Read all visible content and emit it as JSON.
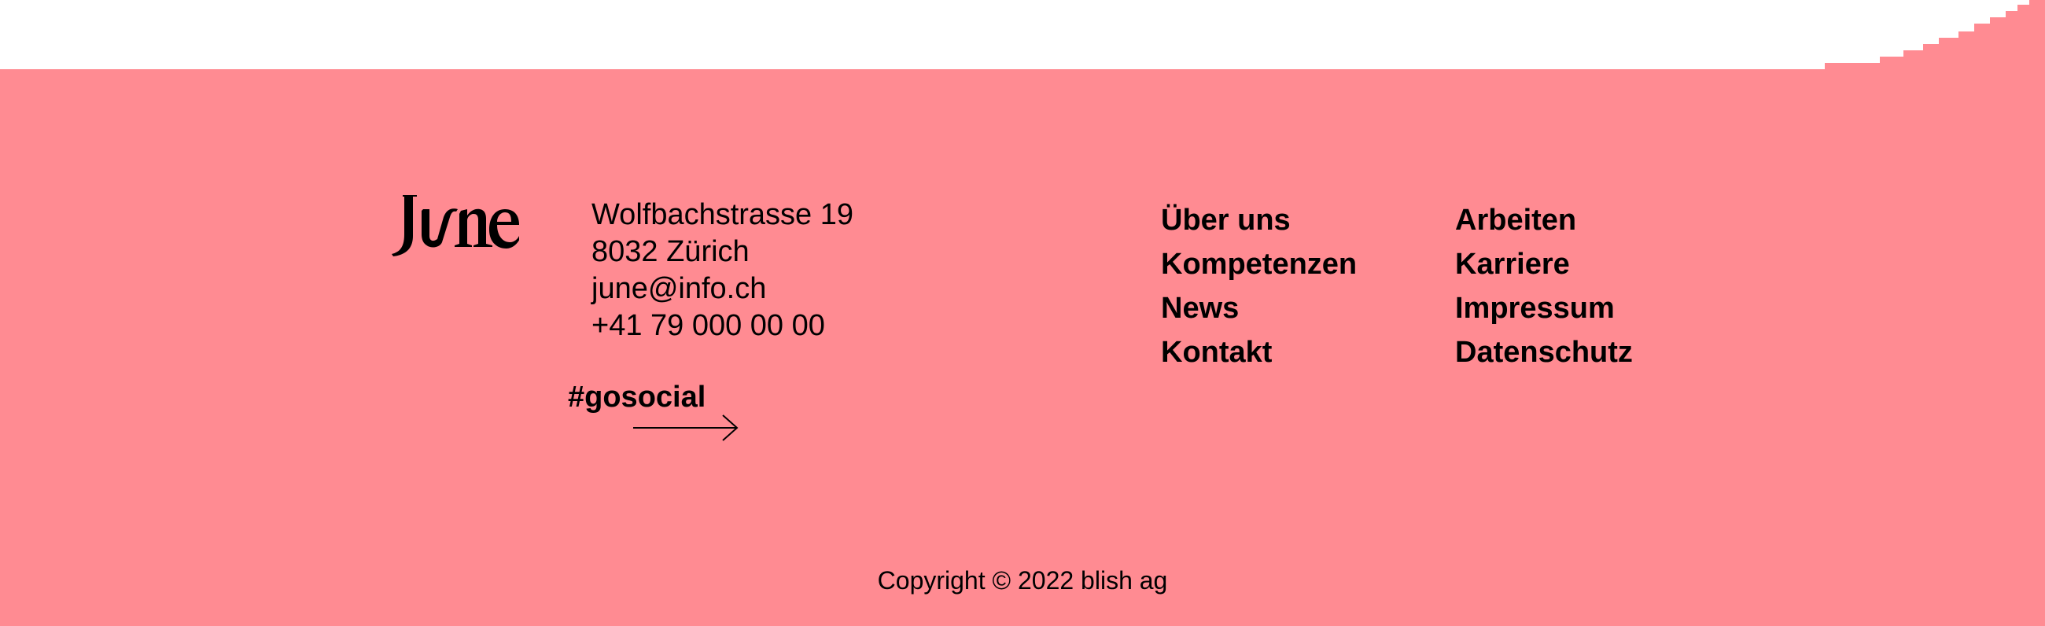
{
  "colors": {
    "footer_background": "#ff8b92",
    "page_background": "#ffffff",
    "text": "#000000"
  },
  "logo": {
    "text": "June",
    "icon": "june-wordmark-logo"
  },
  "address": {
    "street": "Wolfbachstrasse 19",
    "city": "8032 Zürich",
    "email": "june@info.ch",
    "phone": "+41 79 000 00 00"
  },
  "social": {
    "label": "#gosocial",
    "icon": "arrow-right-icon"
  },
  "nav": {
    "column_1": [
      {
        "label": "Über uns"
      },
      {
        "label": "Kompetenzen"
      },
      {
        "label": "News"
      },
      {
        "label": "Kontakt"
      }
    ],
    "column_2": [
      {
        "label": "Arbeiten"
      },
      {
        "label": "Karriere"
      },
      {
        "label": "Impressum"
      },
      {
        "label": "Datenschutz"
      }
    ]
  },
  "copyright": "Copyright © 2022 blish ag"
}
